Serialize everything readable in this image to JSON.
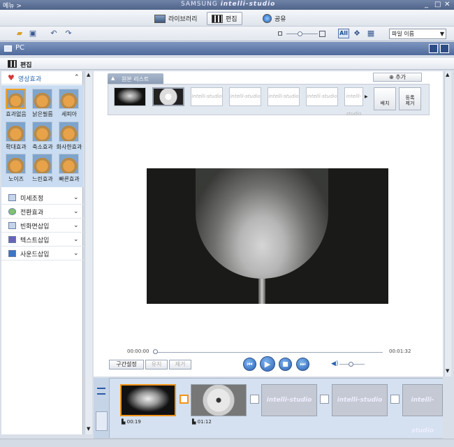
{
  "titlebar": {
    "menu_label": "메뉴 >",
    "brand_top": "SAMSUNG",
    "brand_name": "intelli-studio",
    "minimize": "_",
    "maximize": "□",
    "close": "✕"
  },
  "nav": {
    "tabs": [
      {
        "label": "라이브러리",
        "active": false
      },
      {
        "label": "편집",
        "active": true
      },
      {
        "label": "공유",
        "active": false
      }
    ]
  },
  "toolbar": {
    "view_all_label": "All",
    "sort_select": {
      "value": "파일 이름"
    }
  },
  "pc_bar": {
    "label": "PC"
  },
  "edit_bar": {
    "label": "편집"
  },
  "left_panel": {
    "effects_header": "영상효과",
    "effects": [
      {
        "label": "효과없음",
        "selected": true
      },
      {
        "label": "낡은필름",
        "selected": false
      },
      {
        "label": "세피아",
        "selected": false
      },
      {
        "label": "확대효과",
        "selected": false
      },
      {
        "label": "축소효과",
        "selected": false
      },
      {
        "label": "화사한효과",
        "selected": false
      },
      {
        "label": "노이즈",
        "selected": false
      },
      {
        "label": "느린효과",
        "selected": false
      },
      {
        "label": "빠른효과",
        "selected": false
      }
    ],
    "accordion": [
      {
        "label": "미세조정",
        "icon": "adjust-icon"
      },
      {
        "label": "전환효과",
        "icon": "transition-icon"
      },
      {
        "label": "빈화면삽입",
        "icon": "blank-screen-icon"
      },
      {
        "label": "텍스트삽입",
        "icon": "text-icon"
      },
      {
        "label": "사운드삽입",
        "icon": "sound-icon"
      }
    ]
  },
  "source_list": {
    "tab_label": "원본 리스트",
    "add_button": "추가",
    "place_button": "배치",
    "remove_button_line1": "등록",
    "remove_button_line2": "제거",
    "placeholder_text": "intelli-studio"
  },
  "player": {
    "time_start": "00:00:00",
    "time_end": "00:01:32",
    "progress": 0,
    "volume": 0.45,
    "segment_button": "구간설정",
    "keep_button": "유지",
    "delete_button": "제거"
  },
  "storyboard": {
    "clips": [
      {
        "duration": "00:19",
        "selected": true,
        "type": "glass"
      },
      {
        "duration": "01:12",
        "selected": false,
        "type": "clock"
      },
      {
        "placeholder": "intelli-studio"
      },
      {
        "placeholder": "intelli-studio"
      },
      {
        "placeholder": "intelli-studio"
      }
    ]
  },
  "colors": {
    "titlebar": "#5b6f95",
    "accent_selection": "#f29318",
    "effects_bg": "#c9dcf1",
    "pc_bar": "#6580b0"
  }
}
